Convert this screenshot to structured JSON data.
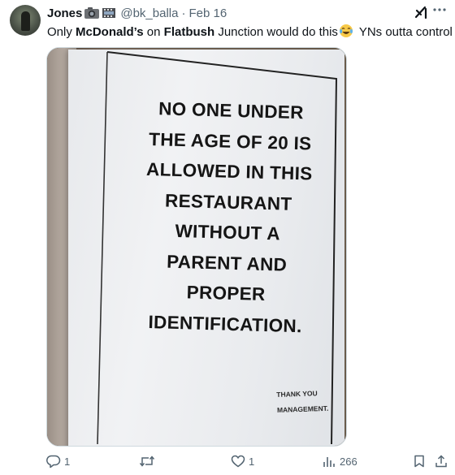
{
  "post": {
    "author_name": "Jones",
    "author_handle": "@bk_balla",
    "separator": "·",
    "date": "Feb 16",
    "text_parts": [
      "Only ",
      "McDonald’s",
      " on ",
      "Flatbush",
      " Junction would do this",
      " YNs outta control"
    ]
  },
  "sign": {
    "lines": [
      "NO ONE UNDER",
      "THE AGE OF 20 IS",
      "ALLOWED IN THIS",
      "RESTAURANT",
      "WITHOUT A",
      "PARENT AND",
      "PROPER",
      "IDENTIFICATION."
    ],
    "footer": [
      "THANK YOU",
      "MANAGEMENT."
    ]
  },
  "actions": {
    "replies": "1",
    "reposts": "",
    "likes": "1",
    "views": "266"
  },
  "icons": {
    "header_emoji": [
      "camera-emoji",
      "film-frames-emoji"
    ],
    "inline_emoji": "laughing-tears-emoji",
    "grok": "grok-icon",
    "more": "more-icon",
    "reply": "reply-icon",
    "repost": "repost-icon",
    "like": "like-icon",
    "views": "views-icon",
    "bookmark": "bookmark-icon",
    "share": "share-icon"
  },
  "colors": {
    "text": "#0f1419",
    "secondary": "#536471",
    "border": "#cfd9de"
  }
}
